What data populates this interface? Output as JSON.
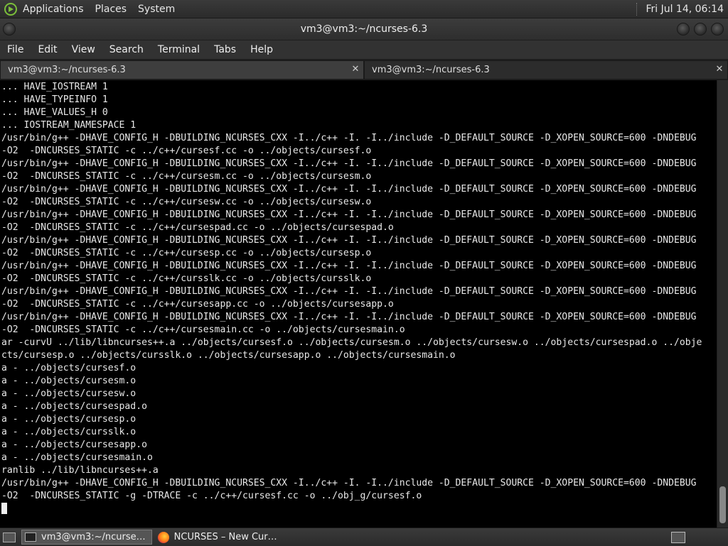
{
  "top_panel": {
    "menus": [
      "Applications",
      "Places",
      "System"
    ],
    "clock": "Fri Jul 14, 06:14"
  },
  "window": {
    "title": "vm3@vm3:~/ncurses-6.3"
  },
  "menubar": [
    "File",
    "Edit",
    "View",
    "Search",
    "Terminal",
    "Tabs",
    "Help"
  ],
  "tabs": [
    {
      "label": "vm3@vm3:~/ncurses-6.3",
      "active": true
    },
    {
      "label": "vm3@vm3:~/ncurses-6.3",
      "active": false
    }
  ],
  "terminal": {
    "lines": [
      "... HAVE_IOSTREAM 1",
      "... HAVE_TYPEINFO 1",
      "... HAVE_VALUES_H 0",
      "... IOSTREAM_NAMESPACE 1",
      "/usr/bin/g++ -DHAVE_CONFIG_H -DBUILDING_NCURSES_CXX -I../c++ -I. -I../include -D_DEFAULT_SOURCE -D_XOPEN_SOURCE=600 -DNDEBUG",
      "-O2  -DNCURSES_STATIC -c ../c++/cursesf.cc -o ../objects/cursesf.o",
      "/usr/bin/g++ -DHAVE_CONFIG_H -DBUILDING_NCURSES_CXX -I../c++ -I. -I../include -D_DEFAULT_SOURCE -D_XOPEN_SOURCE=600 -DNDEBUG",
      "-O2  -DNCURSES_STATIC -c ../c++/cursesm.cc -o ../objects/cursesm.o",
      "/usr/bin/g++ -DHAVE_CONFIG_H -DBUILDING_NCURSES_CXX -I../c++ -I. -I../include -D_DEFAULT_SOURCE -D_XOPEN_SOURCE=600 -DNDEBUG",
      "-O2  -DNCURSES_STATIC -c ../c++/cursesw.cc -o ../objects/cursesw.o",
      "/usr/bin/g++ -DHAVE_CONFIG_H -DBUILDING_NCURSES_CXX -I../c++ -I. -I../include -D_DEFAULT_SOURCE -D_XOPEN_SOURCE=600 -DNDEBUG",
      "-O2  -DNCURSES_STATIC -c ../c++/cursespad.cc -o ../objects/cursespad.o",
      "/usr/bin/g++ -DHAVE_CONFIG_H -DBUILDING_NCURSES_CXX -I../c++ -I. -I../include -D_DEFAULT_SOURCE -D_XOPEN_SOURCE=600 -DNDEBUG",
      "-O2  -DNCURSES_STATIC -c ../c++/cursesp.cc -o ../objects/cursesp.o",
      "/usr/bin/g++ -DHAVE_CONFIG_H -DBUILDING_NCURSES_CXX -I../c++ -I. -I../include -D_DEFAULT_SOURCE -D_XOPEN_SOURCE=600 -DNDEBUG",
      "-O2  -DNCURSES_STATIC -c ../c++/cursslk.cc -o ../objects/cursslk.o",
      "/usr/bin/g++ -DHAVE_CONFIG_H -DBUILDING_NCURSES_CXX -I../c++ -I. -I../include -D_DEFAULT_SOURCE -D_XOPEN_SOURCE=600 -DNDEBUG",
      "-O2  -DNCURSES_STATIC -c ../c++/cursesapp.cc -o ../objects/cursesapp.o",
      "/usr/bin/g++ -DHAVE_CONFIG_H -DBUILDING_NCURSES_CXX -I../c++ -I. -I../include -D_DEFAULT_SOURCE -D_XOPEN_SOURCE=600 -DNDEBUG",
      "-O2  -DNCURSES_STATIC -c ../c++/cursesmain.cc -o ../objects/cursesmain.o",
      "ar -curvU ../lib/libncurses++.a ../objects/cursesf.o ../objects/cursesm.o ../objects/cursesw.o ../objects/cursespad.o ../obje",
      "cts/cursesp.o ../objects/cursslk.o ../objects/cursesapp.o ../objects/cursesmain.o",
      "a - ../objects/cursesf.o",
      "a - ../objects/cursesm.o",
      "a - ../objects/cursesw.o",
      "a - ../objects/cursespad.o",
      "a - ../objects/cursesp.o",
      "a - ../objects/cursslk.o",
      "a - ../objects/cursesapp.o",
      "a - ../objects/cursesmain.o",
      "ranlib ../lib/libncurses++.a",
      "/usr/bin/g++ -DHAVE_CONFIG_H -DBUILDING_NCURSES_CXX -I../c++ -I. -I../include -D_DEFAULT_SOURCE -D_XOPEN_SOURCE=600 -DNDEBUG",
      "-O2  -DNCURSES_STATIC -g -DTRACE -c ../c++/cursesf.cc -o ../obj_g/cursesf.o"
    ]
  },
  "taskbar": {
    "tasks": [
      {
        "label": "vm3@vm3:~/ncurse…",
        "icon": "terminal-icon",
        "active": true
      },
      {
        "label": "NCURSES – New Cur…",
        "icon": "firefox-icon",
        "active": false
      }
    ]
  }
}
